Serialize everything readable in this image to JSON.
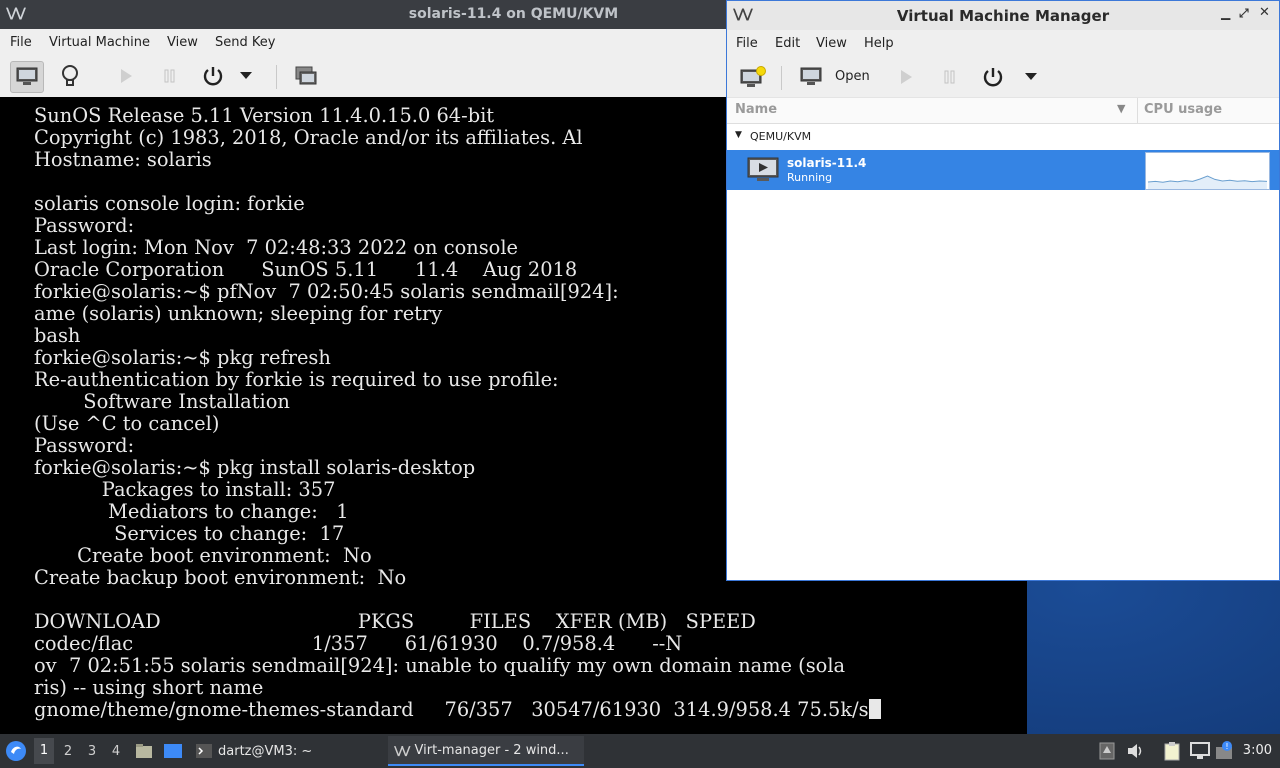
{
  "vm_console": {
    "title": "solaris-11.4 on QEMU/KVM",
    "menu": [
      "File",
      "Virtual Machine",
      "View",
      "Send Key"
    ],
    "console_lines": [
      "SunOS Release 5.11 Version 11.4.0.15.0 64-bit",
      "Copyright (c) 1983, 2018, Oracle and/or its affiliates. Al",
      "Hostname: solaris",
      "",
      "solaris console login: forkie",
      "Password:",
      "Last login: Mon Nov  7 02:48:33 2022 on console",
      "Oracle Corporation      SunOS 5.11      11.4    Aug 2018",
      "forkie@solaris:~$ pfNov  7 02:50:45 solaris sendmail[924]:",
      "ame (solaris) unknown; sleeping for retry",
      "bash",
      "forkie@solaris:~$ pkg refresh",
      "Re-authentication by forkie is required to use profile:",
      "        Software Installation",
      "(Use ^C to cancel)",
      "Password:",
      "forkie@solaris:~$ pkg install solaris-desktop",
      "           Packages to install: 357",
      "            Mediators to change:   1",
      "             Services to change:  17",
      "       Create boot environment:  No",
      "Create backup boot environment:  No",
      "",
      "DOWNLOAD                                PKGS         FILES    XFER (MB)   SPEED",
      "codec/flac                             1/357      61/61930    0.7/958.4      --N",
      "ov  7 02:51:55 solaris sendmail[924]: unable to qualify my own domain name (sola",
      "ris) -- using short name",
      "gnome/theme/gnome-themes-standard     76/357   30547/61930  314.9/958.4 75.5k/s"
    ]
  },
  "vmm": {
    "title": "Virtual Machine Manager",
    "menu": [
      "File",
      "Edit",
      "View",
      "Help"
    ],
    "open_label": "Open",
    "col_name": "Name",
    "col_cpu": "CPU usage",
    "group": "QEMU/KVM",
    "vm_name": "solaris-11.4",
    "vm_status": "Running",
    "cpu_usage_series": [
      0.15,
      0.18,
      0.14,
      0.2,
      0.16,
      0.22,
      0.18,
      0.3,
      0.45,
      0.28,
      0.2,
      0.24,
      0.19,
      0.21,
      0.17,
      0.2,
      0.18
    ]
  },
  "taskbar": {
    "workspaces": [
      "1",
      "2",
      "3",
      "4"
    ],
    "active_workspace": "1",
    "tasks": [
      "dartz@VM3: ~",
      "Virt-manager - 2 wind..."
    ],
    "clock": "3:00"
  },
  "colors": {
    "selection": "#3584e4",
    "console_bg": "#000000",
    "taskbar_bg": "#2f3236"
  }
}
